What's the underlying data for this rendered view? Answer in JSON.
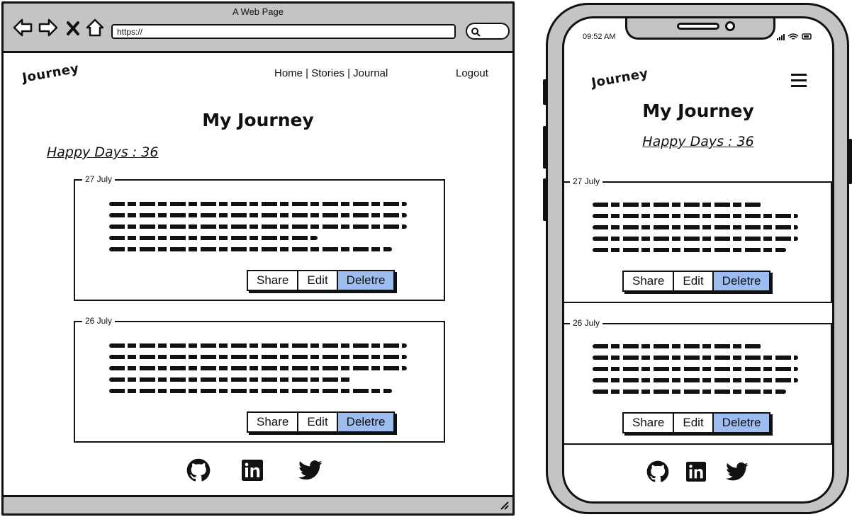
{
  "browser": {
    "title": "A Web Page",
    "url": "https://",
    "icons": [
      "back-arrow-icon",
      "forward-arrow-icon",
      "close-icon",
      "home-icon",
      "search-icon"
    ]
  },
  "site": {
    "logo": "Journey",
    "nav_links": "Home | Stories | Journal",
    "logout": "Logout",
    "page_title": "My Journey",
    "happy_days": "Happy Days : 36"
  },
  "entries": [
    {
      "date": "27 July",
      "share": "Share",
      "edit": "Edit",
      "delete": "Deletre"
    },
    {
      "date": "26 July",
      "share": "Share",
      "edit": "Edit",
      "delete": "Deletre"
    }
  ],
  "social": [
    "github-icon",
    "linkedin-icon",
    "twitter-icon"
  ],
  "phone": {
    "time": "09:52 AM",
    "menu_icon": "hamburger-menu-icon"
  },
  "colors": {
    "chrome_gray": "#c4c4c4",
    "delete_button": "#9dbdf0",
    "ink": "#111111"
  }
}
